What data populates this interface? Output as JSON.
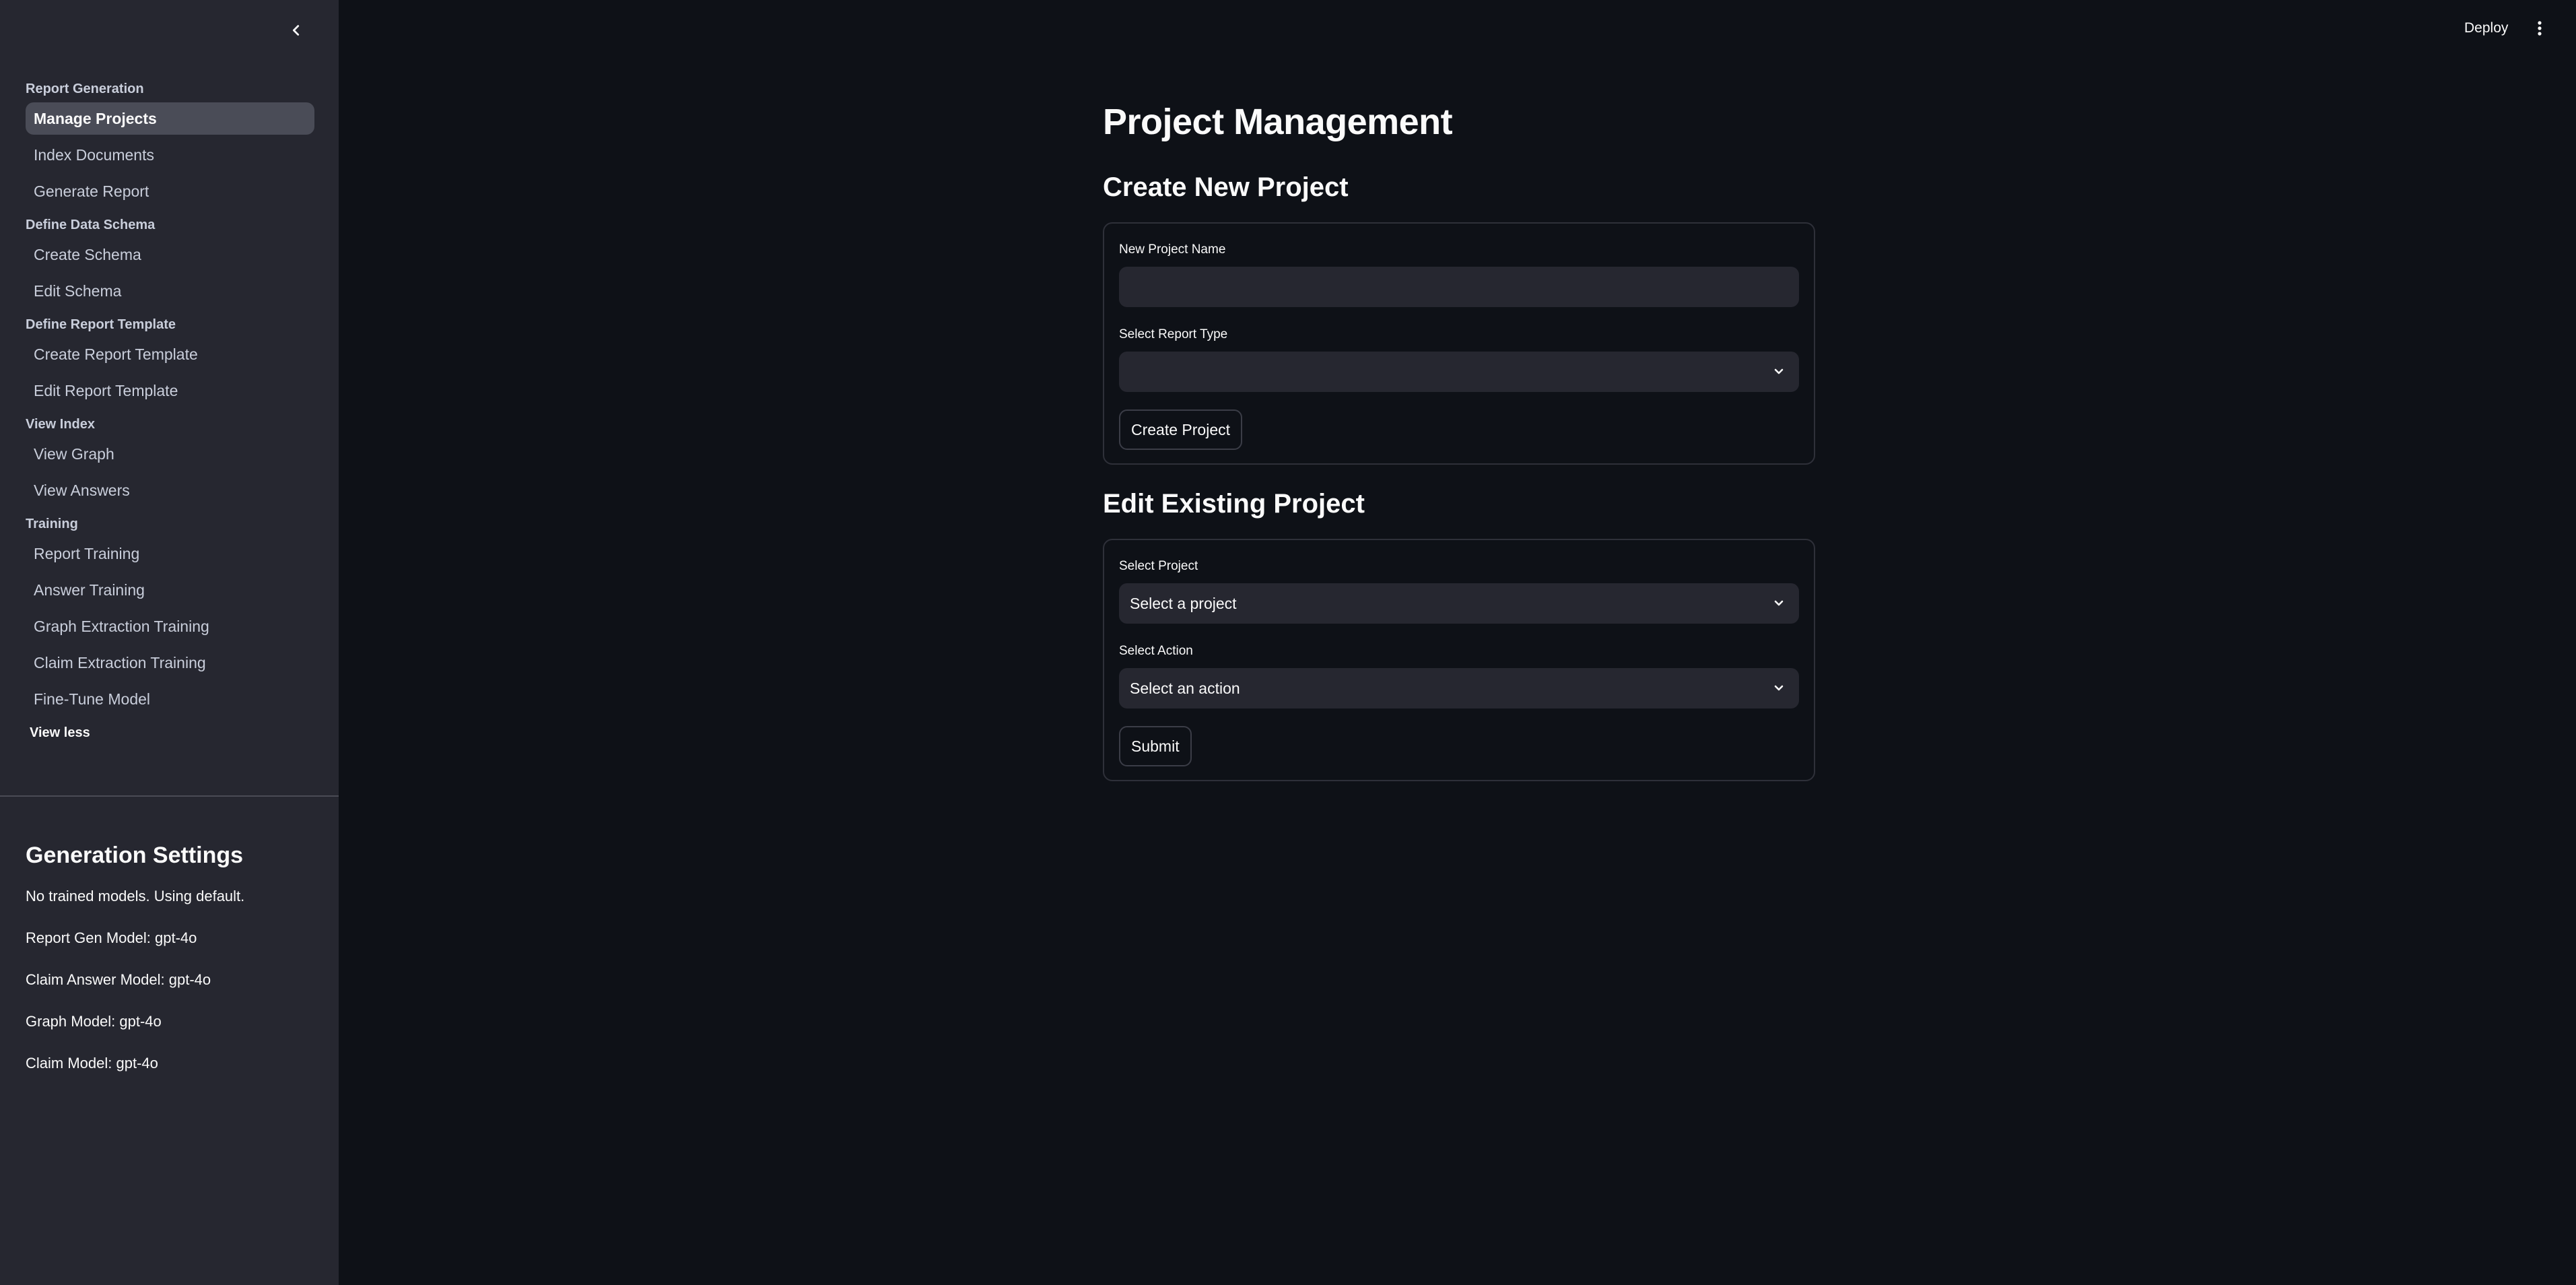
{
  "sidebar": {
    "collapse_icon": "chevron-left-icon",
    "sections": [
      {
        "header": "Report Generation",
        "items": [
          {
            "label": "Manage Projects",
            "active": true
          },
          {
            "label": "Index Documents",
            "active": false
          },
          {
            "label": "Generate Report",
            "active": false
          }
        ]
      },
      {
        "header": "Define Data Schema",
        "items": [
          {
            "label": "Create Schema",
            "active": false
          },
          {
            "label": "Edit Schema",
            "active": false
          }
        ]
      },
      {
        "header": "Define Report Template",
        "items": [
          {
            "label": "Create Report Template",
            "active": false
          },
          {
            "label": "Edit Report Template",
            "active": false
          }
        ]
      },
      {
        "header": "View Index",
        "items": [
          {
            "label": "View Graph",
            "active": false
          },
          {
            "label": "View Answers",
            "active": false
          }
        ]
      },
      {
        "header": "Training",
        "items": [
          {
            "label": "Report Training",
            "active": false
          },
          {
            "label": "Answer Training",
            "active": false
          },
          {
            "label": "Graph Extraction Training",
            "active": false
          },
          {
            "label": "Claim Extraction Training",
            "active": false
          },
          {
            "label": "Fine-Tune Model",
            "active": false
          }
        ]
      }
    ],
    "view_less_label": "View less",
    "generation_settings": {
      "title": "Generation Settings",
      "lines": [
        "No trained models. Using default.",
        "Report Gen Model: gpt-4o",
        "Claim Answer Model: gpt-4o",
        "Graph Model: gpt-4o",
        "Claim Model: gpt-4o"
      ]
    }
  },
  "header": {
    "deploy_label": "Deploy",
    "menu_icon": "more-vertical-icon"
  },
  "main": {
    "page_title": "Project Management",
    "create_section": {
      "title": "Create New Project",
      "name_field": {
        "label": "New Project Name",
        "value": "",
        "placeholder": ""
      },
      "report_type_select": {
        "label": "Select Report Type",
        "value": ""
      },
      "submit_label": "Create Project"
    },
    "edit_section": {
      "title": "Edit Existing Project",
      "project_select": {
        "label": "Select Project",
        "value": "Select a project"
      },
      "action_select": {
        "label": "Select Action",
        "value": "Select an action"
      },
      "submit_label": "Submit"
    }
  },
  "colors": {
    "sidebar_bg": "#262730",
    "main_bg": "#0e1117",
    "active_item_bg": "#4a4c57",
    "input_bg": "#262730",
    "text": "#fafafa"
  }
}
